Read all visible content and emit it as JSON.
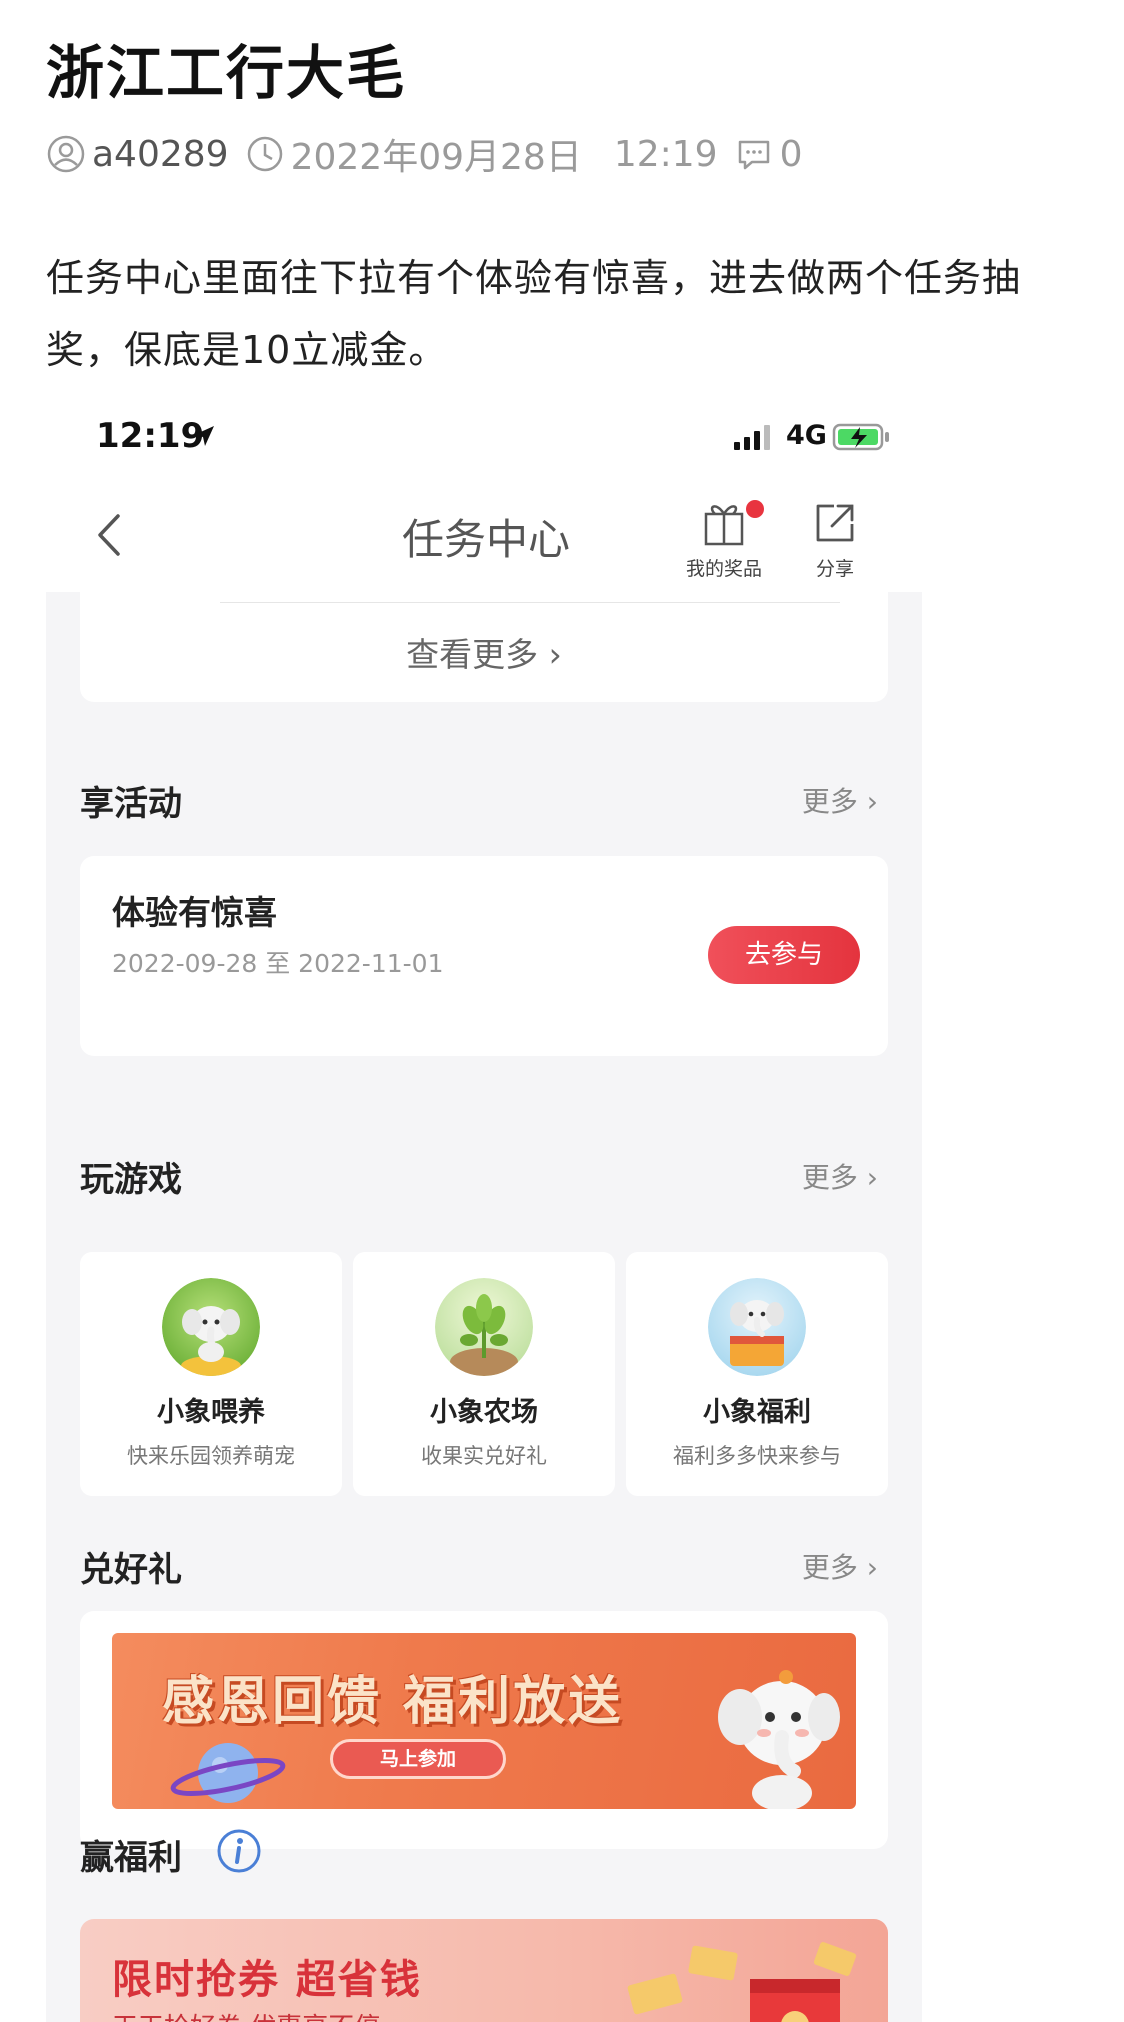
{
  "article": {
    "title": "浙江工行大毛",
    "author": "a40289",
    "date": "2022年09月28日",
    "time": "12:19",
    "comment_count": "0",
    "body": "任务中心里面往下拉有个体验有惊喜，进去做两个任务抽奖，保底是10立减金。"
  },
  "status_bar": {
    "time": "12:19",
    "network": "4G"
  },
  "nav": {
    "title": "任务中心",
    "prize_label": "我的奖品",
    "share_label": "分享"
  },
  "view_more": "查看更多",
  "sections": {
    "activity": {
      "title": "享活动",
      "more": "更多"
    },
    "games": {
      "title": "玩游戏",
      "more": "更多"
    },
    "gifts": {
      "title": "兑好礼",
      "more": "更多"
    },
    "welfare": {
      "title": "赢福利"
    }
  },
  "activity": {
    "name": "体验有惊喜",
    "date_range": "2022-09-28 至 2022-11-01",
    "button": "去参与"
  },
  "games": [
    {
      "name": "小象喂养",
      "desc": "快来乐园领养萌宠"
    },
    {
      "name": "小象农场",
      "desc": "收果实兑好礼"
    },
    {
      "name": "小象福利",
      "desc": "福利多多快来参与"
    }
  ],
  "banner": {
    "title": "感恩回馈 福利放送",
    "button": "马上参加"
  },
  "promo": {
    "title": "限时抢券 超省钱",
    "subtitle": "天天抢好券 优惠享不停"
  },
  "colors": {
    "accent_red": "#e4343e",
    "banner_orange": "#ef7a4c",
    "page_bg": "#f5f5f7"
  }
}
